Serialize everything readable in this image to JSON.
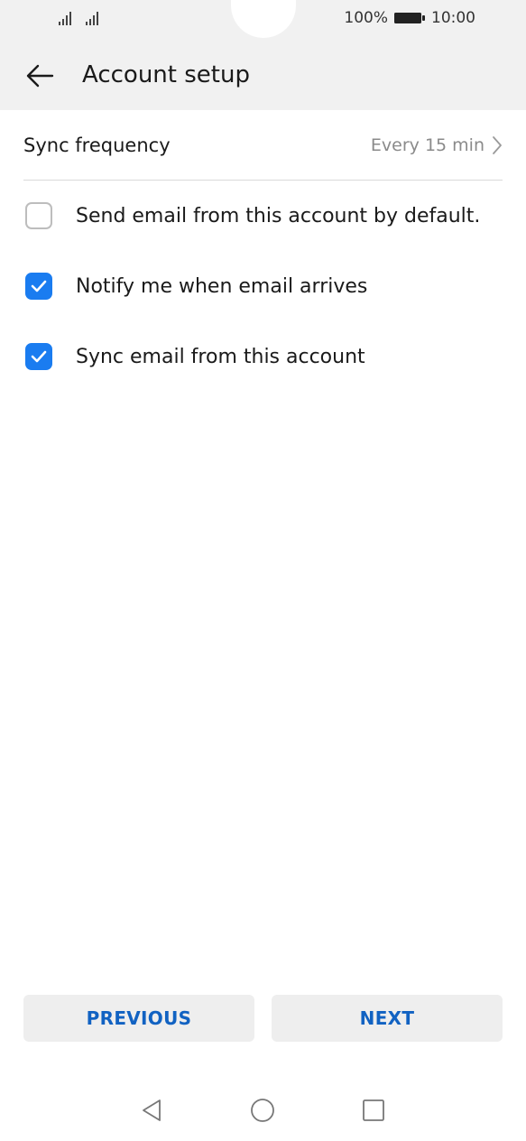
{
  "statusbar": {
    "battery_text": "100%",
    "time": "10:00"
  },
  "header": {
    "title": "Account setup"
  },
  "settings": {
    "sync_frequency": {
      "label": "Sync frequency",
      "value": "Every 15 min"
    },
    "options": [
      {
        "label": "Send email from this account by default.",
        "checked": false
      },
      {
        "label": "Notify me when email arrives",
        "checked": true
      },
      {
        "label": "Sync email from this account",
        "checked": true
      }
    ]
  },
  "footer": {
    "previous_label": "PREVIOUS",
    "next_label": "NEXT"
  },
  "colors": {
    "accent": "#1a7cf0",
    "button_text": "#1162c2",
    "bar_bg": "#f1f1f1"
  }
}
